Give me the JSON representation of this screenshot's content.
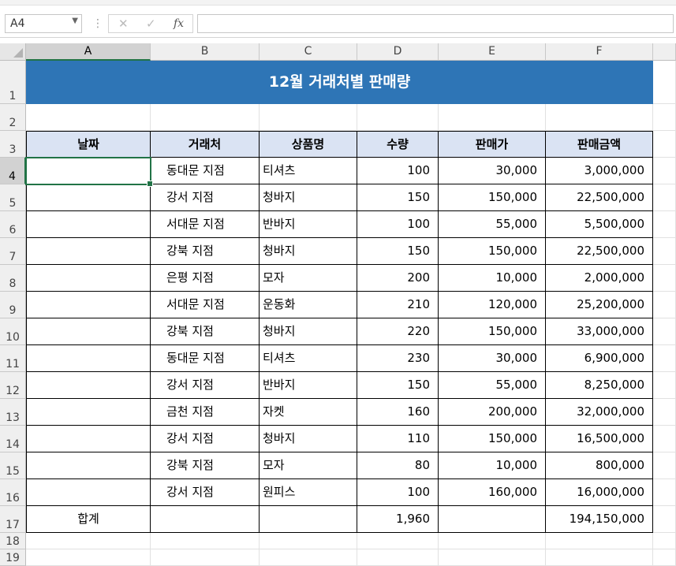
{
  "formula_bar": {
    "name_box": "A4",
    "cancel_icon": "✕",
    "enter_icon": "✓",
    "fx_label": "fx",
    "formula": ""
  },
  "columns": [
    "A",
    "B",
    "C",
    "D",
    "E",
    "F"
  ],
  "rows": [
    "1",
    "2",
    "3",
    "4",
    "5",
    "6",
    "7",
    "8",
    "9",
    "10",
    "11",
    "12",
    "13",
    "14",
    "15",
    "16",
    "17",
    "18",
    "19"
  ],
  "sheet": {
    "title": "12월 거래처별 판매량",
    "headers": [
      "날짜",
      "거래처",
      "상품명",
      "수량",
      "판매가",
      "판매금액"
    ],
    "data_rows": [
      [
        "",
        "동대문 지점",
        "티셔츠",
        "100",
        "30,000",
        "3,000,000"
      ],
      [
        "",
        "강서 지점",
        "청바지",
        "150",
        "150,000",
        "22,500,000"
      ],
      [
        "",
        "서대문 지점",
        "반바지",
        "100",
        "55,000",
        "5,500,000"
      ],
      [
        "",
        "강북 지점",
        "청바지",
        "150",
        "150,000",
        "22,500,000"
      ],
      [
        "",
        "은평 지점",
        "모자",
        "200",
        "10,000",
        "2,000,000"
      ],
      [
        "",
        "서대문 지점",
        "운동화",
        "210",
        "120,000",
        "25,200,000"
      ],
      [
        "",
        "강북 지점",
        "청바지",
        "220",
        "150,000",
        "33,000,000"
      ],
      [
        "",
        "동대문 지점",
        "티셔츠",
        "230",
        "30,000",
        "6,900,000"
      ],
      [
        "",
        "강서 지점",
        "반바지",
        "150",
        "55,000",
        "8,250,000"
      ],
      [
        "",
        "금천 지점",
        "자켓",
        "160",
        "200,000",
        "32,000,000"
      ],
      [
        "",
        "강서  지점",
        "청바지",
        "110",
        "150,000",
        "16,500,000"
      ],
      [
        "",
        "강북 지점",
        "모자",
        "80",
        "10,000",
        "800,000"
      ],
      [
        "",
        "강서 지점",
        "원피스",
        "100",
        "160,000",
        "16,000,000"
      ]
    ],
    "total_row": [
      "합계",
      "",
      "",
      "1,960",
      "",
      "194,150,000"
    ]
  },
  "colors": {
    "title_fill": "#2e75b6",
    "header_fill": "#dae3f3",
    "selection": "#217346"
  }
}
